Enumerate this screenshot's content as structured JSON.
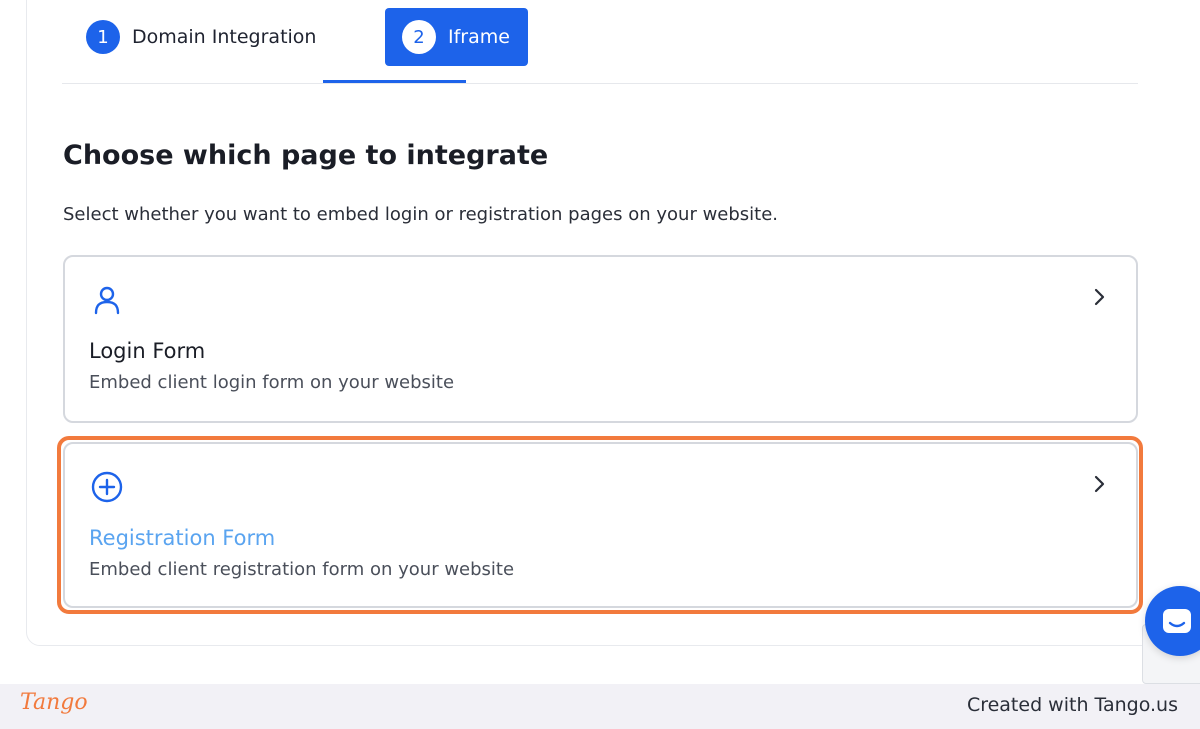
{
  "tabs": [
    {
      "number": "1",
      "label": "Domain Integration",
      "active": false
    },
    {
      "number": "2",
      "label": "Iframe",
      "active": true
    }
  ],
  "main": {
    "heading": "Choose which page to integrate",
    "subheading": "Select whether you want to embed login or registration pages on your website."
  },
  "options": [
    {
      "icon": "user-icon",
      "title": "Login Form",
      "description": "Embed client login form on your website"
    },
    {
      "icon": "plus-circle-icon",
      "title": "Registration Form",
      "description": "Embed client registration form on your website",
      "highlighted": true
    }
  ],
  "footer": {
    "logo": "Tango",
    "credit": "Created with Tango.us"
  },
  "colors": {
    "accent": "#1d63ea",
    "highlight": "#f27a3d",
    "registration_title": "#5aa4f0"
  }
}
